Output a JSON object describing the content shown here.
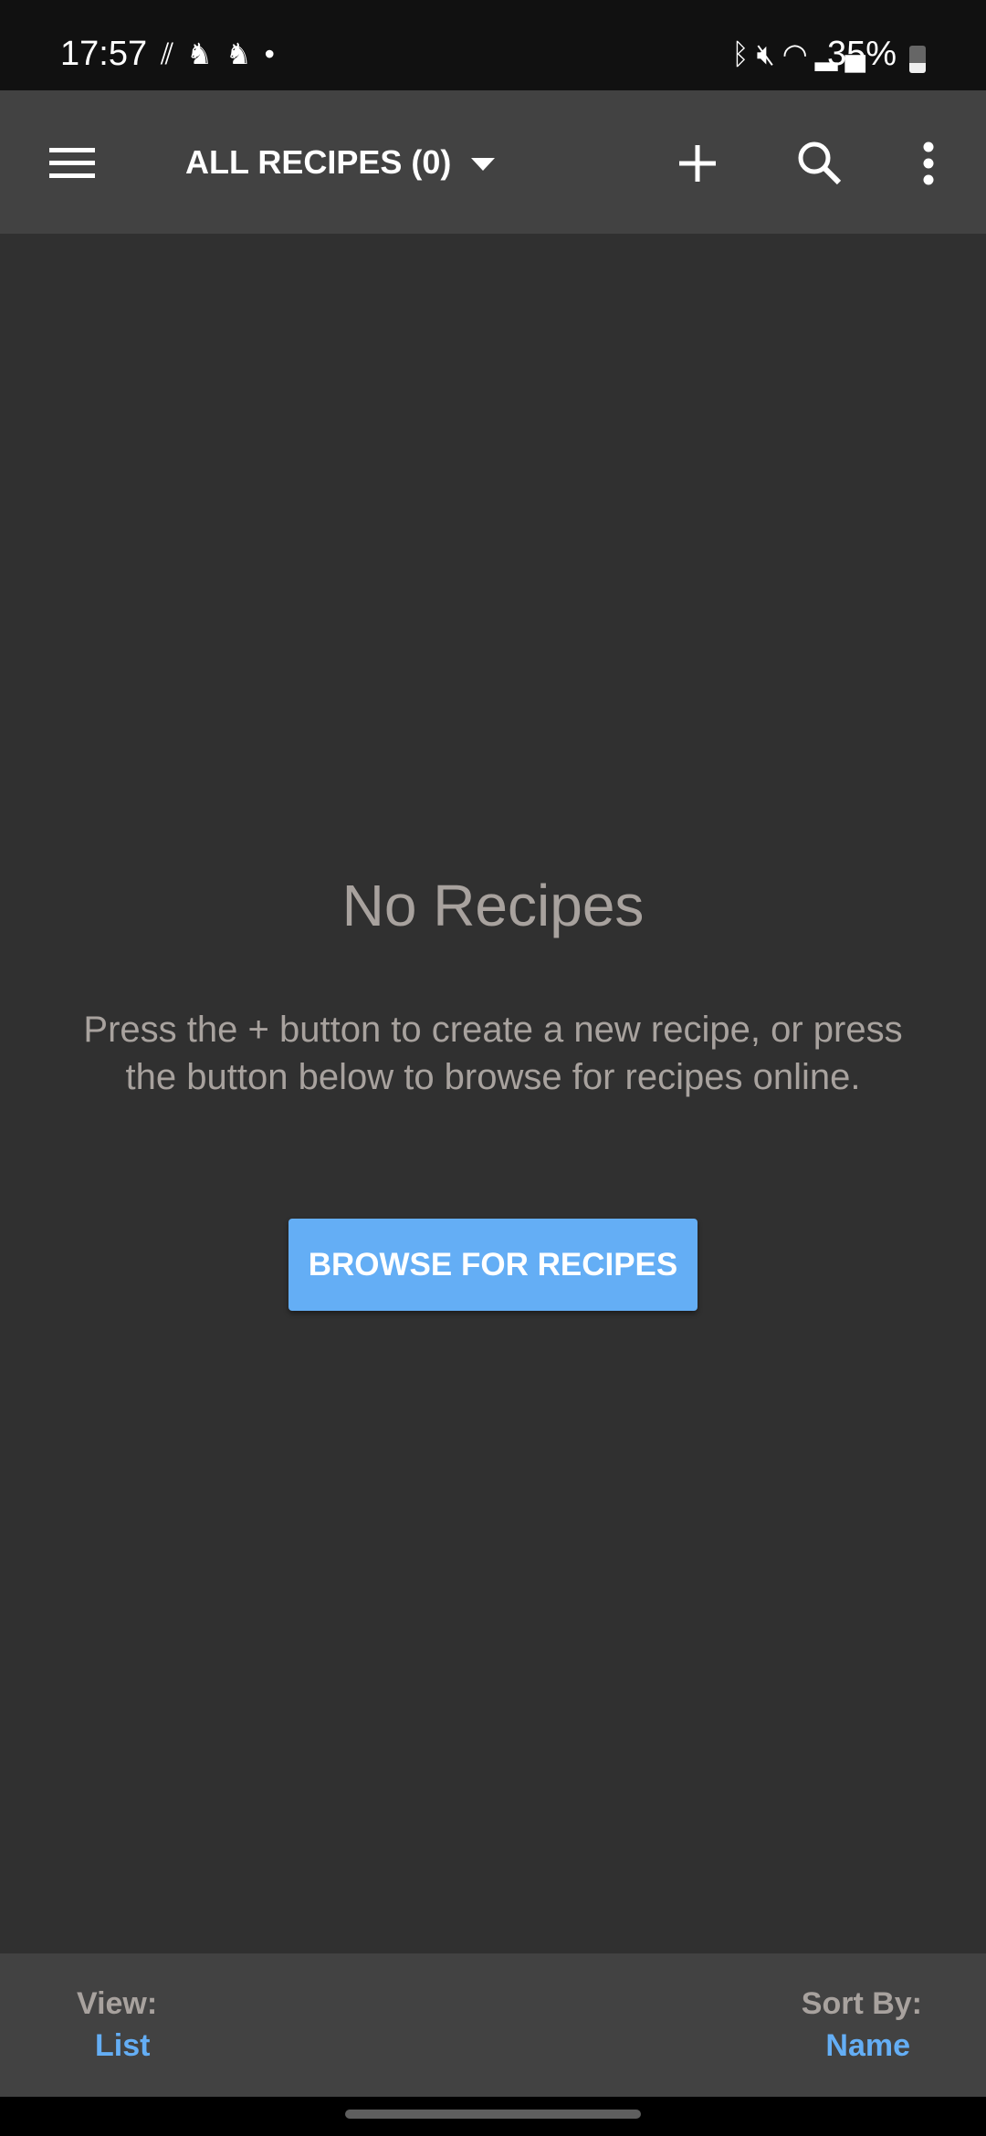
{
  "status_bar": {
    "time": "17:57",
    "notification_icons": [
      "data-saver-icon",
      "app-notification-icon",
      "app-notification-icon",
      "dot-icon"
    ],
    "system_icons": [
      "bluetooth-icon",
      "mute-icon",
      "wifi-icon",
      "signal-icon"
    ],
    "battery": "35%",
    "battery_level": 35
  },
  "toolbar": {
    "title": "ALL RECIPES (0)",
    "actions": [
      "plus-icon",
      "search-icon",
      "more-vert-icon"
    ]
  },
  "empty_state": {
    "title": "No Recipes",
    "message": "Press the + button to create a new recipe, or press the button below to browse for recipes online.",
    "button_label": "BROWSE FOR RECIPES"
  },
  "bottom_bar": {
    "view_label": "View:",
    "view_value": "List",
    "sort_label": "Sort By:",
    "sort_value": "Name"
  },
  "colors": {
    "accent": "#64aef5",
    "background": "#303030",
    "toolbar": "#424242",
    "muted_text": "#a8a29e"
  }
}
